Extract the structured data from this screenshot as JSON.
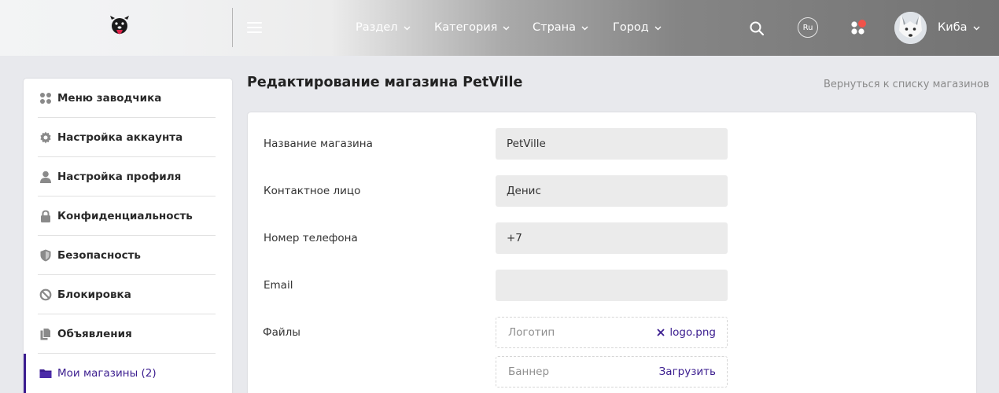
{
  "header": {
    "nav": [
      {
        "label": "Раздел"
      },
      {
        "label": "Категория"
      },
      {
        "label": "Страна"
      },
      {
        "label": "Город"
      }
    ],
    "lang": "Ru",
    "user_name": "Киба",
    "icons": [
      "dog-logo-icon",
      "hamburger-menu-icon",
      "chevron-down-icon",
      "search-icon",
      "notifications-icon"
    ],
    "notification_dot_color": "#f0524a"
  },
  "sidebar": {
    "items": [
      {
        "label": "Меню заводчика",
        "icon": "grid-icon"
      },
      {
        "label": "Настройка аккаунта",
        "icon": "gear-icon"
      },
      {
        "label": "Настройка профиля",
        "icon": "user-icon"
      },
      {
        "label": "Конфиденциальность",
        "icon": "lock-icon"
      },
      {
        "label": "Безопасность",
        "icon": "shield-icon"
      },
      {
        "label": "Блокировка",
        "icon": "ban-icon"
      },
      {
        "label": "Объявления",
        "icon": "documents-icon"
      },
      {
        "label": "Мои магазины (2)",
        "icon": "folder-icon",
        "active": true
      }
    ],
    "accent_color": "#3b1d8f"
  },
  "main": {
    "title": "Редактирование магазина PetVille",
    "back_link": "Вернуться к списку магазинов",
    "form": {
      "shop_name": {
        "label": "Название магазина",
        "value": "PetVille"
      },
      "contact": {
        "label": "Контактное лицо",
        "value": "Денис"
      },
      "phone": {
        "label": "Номер телефона",
        "value": "+7"
      },
      "email": {
        "label": "Email",
        "value": ""
      },
      "files": {
        "label": "Файлы",
        "logo": {
          "placeholder": "Логотип",
          "file": "logo.png"
        },
        "banner": {
          "placeholder": "Баннер",
          "action": "Загрузить"
        }
      }
    }
  }
}
